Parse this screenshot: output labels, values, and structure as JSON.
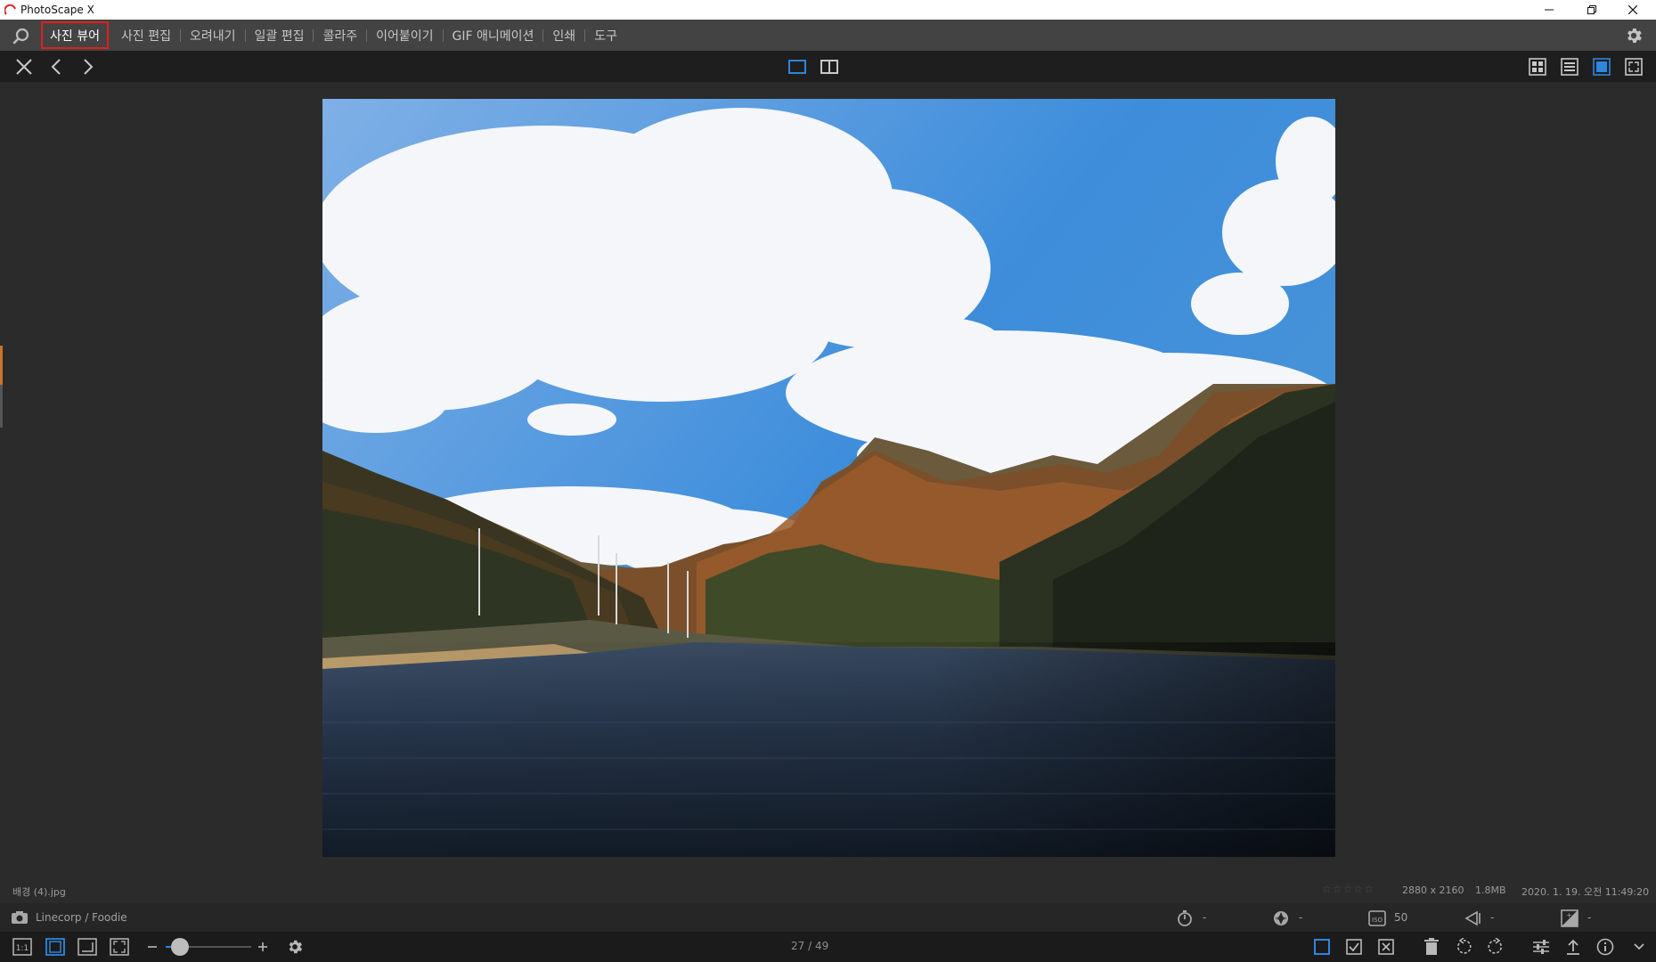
{
  "window": {
    "title": "PhotoScape X"
  },
  "menu": {
    "items": [
      {
        "label": "사진 뷰어"
      },
      {
        "label": "사진 편집"
      },
      {
        "label": "오려내기"
      },
      {
        "label": "일괄 편집"
      },
      {
        "label": "콜라주"
      },
      {
        "label": "이어붙이기"
      },
      {
        "label": "GIF 애니메이션"
      },
      {
        "label": "인쇄"
      },
      {
        "label": "도구"
      }
    ]
  },
  "info": {
    "filename": "배경 (4).jpg",
    "dimensions": "2880 x 2160",
    "filesize": "1.8MB",
    "datetime": "2020. 1. 19. 오전 11:49:20",
    "camera": "Linecorp / Foodie"
  },
  "exif": {
    "exposure": "-",
    "aperture": "-",
    "iso": "50",
    "focal": "-",
    "ev": "-"
  },
  "navigation": {
    "counter": "27 / 49"
  },
  "colors": {
    "accent": "#2e86de",
    "active_outline": "#e02020",
    "side_accent": "#c9742a"
  }
}
